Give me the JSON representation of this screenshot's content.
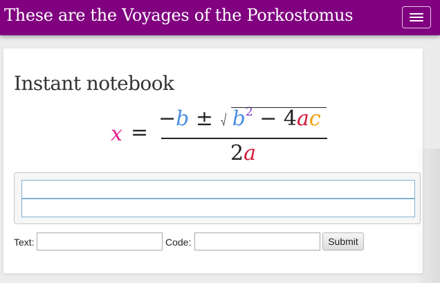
{
  "navbar": {
    "brand": "These are the Voyages of the Porkostomus",
    "toggle_icon": "hamburger-menu-icon",
    "background": "#800080"
  },
  "card": {
    "title": "Instant notebook"
  },
  "formula": {
    "lhs": "x",
    "equals": "=",
    "numerator": {
      "minus": "−",
      "b": "b",
      "plus_minus": "±",
      "b2": "b",
      "exp": "2",
      "minus2": "− 4",
      "a": "a",
      "c": "c"
    },
    "denominator": {
      "two": "2",
      "a": "a"
    },
    "colors": {
      "x": "#e0208f",
      "b": "#4d8fe0",
      "a": "#d11a3a",
      "c": "#f0a000",
      "exponent": "#8b3fc5"
    }
  },
  "form": {
    "text_label": "Text:",
    "text_value": "",
    "code_label": "Code:",
    "code_value": "",
    "submit_label": "Submit"
  }
}
